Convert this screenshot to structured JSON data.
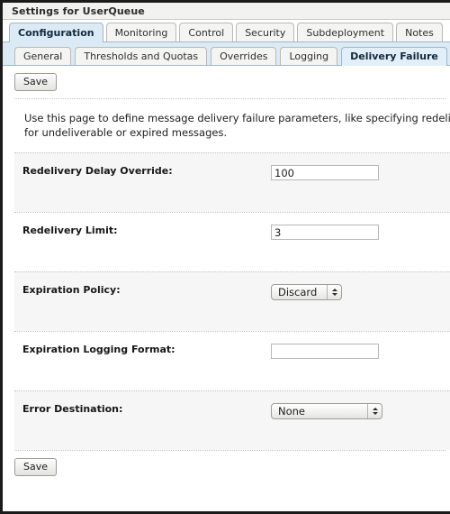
{
  "window": {
    "title": "Settings for UserQueue"
  },
  "primary_tabs": [
    {
      "label": "Configuration",
      "active": true
    },
    {
      "label": "Monitoring",
      "active": false
    },
    {
      "label": "Control",
      "active": false
    },
    {
      "label": "Security",
      "active": false
    },
    {
      "label": "Subdeployment",
      "active": false
    },
    {
      "label": "Notes",
      "active": false
    }
  ],
  "secondary_tabs": [
    {
      "label": "General",
      "active": false
    },
    {
      "label": "Thresholds and Quotas",
      "active": false
    },
    {
      "label": "Overrides",
      "active": false
    },
    {
      "label": "Logging",
      "active": false
    },
    {
      "label": "Delivery Failure",
      "active": true
    }
  ],
  "toolbar": {
    "save_top_label": "Save",
    "save_bottom_label": "Save"
  },
  "description": {
    "line1": "Use this page to define message delivery failure parameters, like specifying redelivery limits, sele",
    "line2": "for undeliverable or expired messages."
  },
  "form": {
    "rows": [
      {
        "label": "Redelivery Delay Override:",
        "type": "text",
        "value": "100",
        "placeholder": ""
      },
      {
        "label": "Redelivery Limit:",
        "type": "text",
        "value": "3",
        "placeholder": ""
      },
      {
        "label": "Expiration Policy:",
        "type": "popup",
        "value": "Discard"
      },
      {
        "label": "Expiration Logging Format:",
        "type": "text",
        "value": "",
        "placeholder": ""
      },
      {
        "label": "Error Destination:",
        "type": "popup",
        "value": "None"
      }
    ]
  },
  "colors": {
    "tab_active": "#dbeaf5",
    "subtab_strip": "#dbeaf5",
    "row_shaded": "#f6f6f6",
    "frame": "#1b1b1b"
  }
}
